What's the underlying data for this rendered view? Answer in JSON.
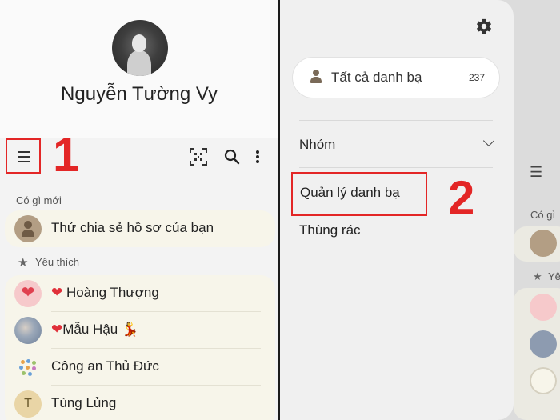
{
  "profile": {
    "name": "Nguyễn Tường Vy"
  },
  "annotations": {
    "step1": "1",
    "step2": "2"
  },
  "sections": {
    "whats_new": "Có gì mới",
    "favorites": "Yêu thích"
  },
  "whats_new_item": "Thử chia sẻ hồ sơ của bạn",
  "favorites": [
    {
      "name": "Hoàng Thượng",
      "prefix_heart": "❤",
      "suffix": ""
    },
    {
      "name": "Mẫu Hậu",
      "prefix_heart": "❤",
      "suffix": "💃"
    },
    {
      "name": "Công an Thủ Đức",
      "prefix_heart": "",
      "suffix": ""
    },
    {
      "name": "Tùng Lủng",
      "prefix_heart": "",
      "suffix": "",
      "initial": "T"
    }
  ],
  "drawer": {
    "all_contacts_label": "Tất cả danh bạ",
    "all_contacts_count": "237",
    "groups_label": "Nhóm",
    "manage_label": "Quản lý danh bạ",
    "trash_label": "Thùng rác"
  },
  "background_peek": {
    "menu_glyph": "☰",
    "whats_new_fragment": "Có gì",
    "favorites_fragment": "Yê"
  },
  "icons": {
    "menu": "hamburger-icon",
    "qr": "qr-code-icon",
    "search": "search-icon",
    "more": "more-vert-icon",
    "settings": "gear-icon",
    "star": "star-icon",
    "person": "person-icon",
    "chevron": "chevron-down-icon"
  },
  "colors": {
    "annotation_red": "#e32626",
    "card_bg": "#f7f5ea",
    "heart": "#e0303a"
  }
}
